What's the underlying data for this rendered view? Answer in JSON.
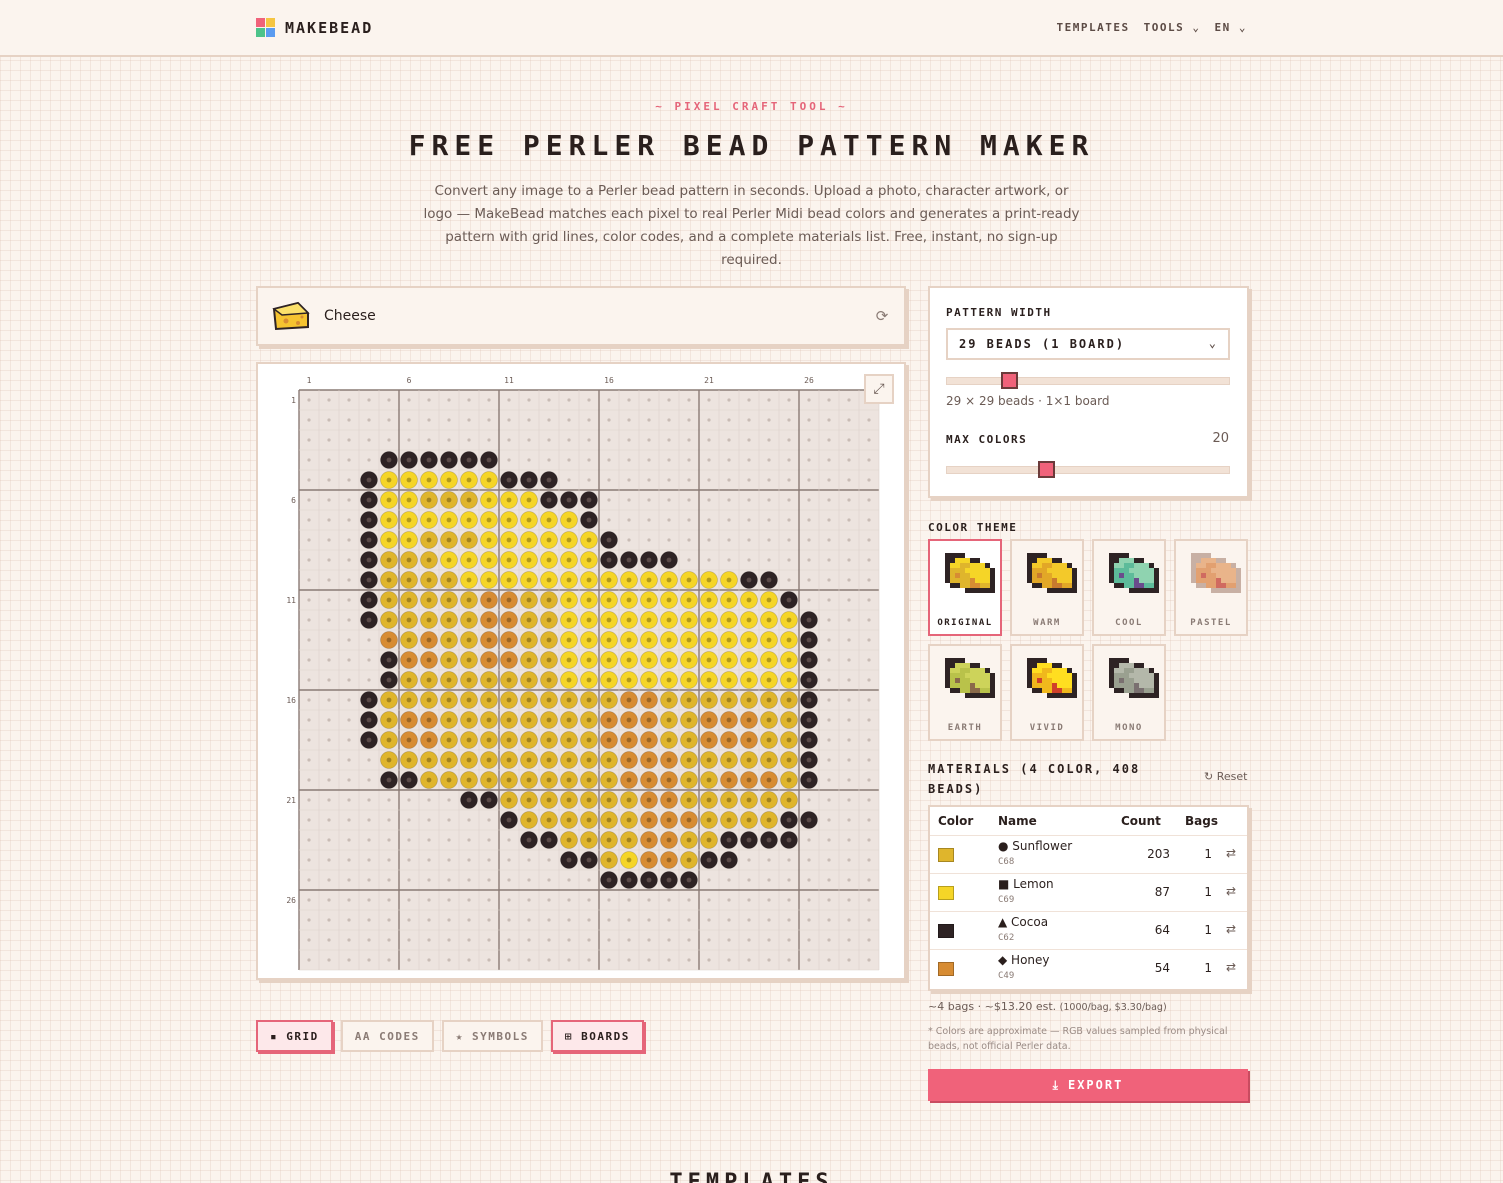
{
  "header": {
    "logo_text": "MAKEBEAD",
    "nav": [
      "TEMPLATES",
      "TOOLS ⌄",
      "EN ⌄"
    ]
  },
  "hero": {
    "kicker": "~ PIXEL CRAFT TOOL ~",
    "title": "FREE PERLER BEAD PATTERN MAKER",
    "description": "Convert any image to a Perler bead pattern in seconds. Upload a photo, character artwork, or logo — MakeBead matches each pixel to real Perler Midi bead colors and generates a print-ready pattern with grid lines, color codes, and a complete materials list. Free, instant, no sign-up required."
  },
  "image": {
    "label": "Cheese"
  },
  "grid": {
    "cols": 29,
    "rows": 29,
    "col_labels": [
      "1",
      "6",
      "11",
      "16",
      "21",
      "26"
    ],
    "row_labels": [
      "1",
      "6",
      "11",
      "16",
      "21",
      "26"
    ],
    "palette": {
      "A": "#dfb52c",
      "B": "#f5d527",
      "C": "#2e2324",
      "D": "#d78c33"
    },
    "rows_data": [
      ".............................",
      ".............................",
      ".............................",
      "....CCCCCC...................",
      "...CBBBBBBCCC................",
      "...CBBAAABBBCCC..............",
      "...CBBBBBBBBBBC..............",
      "...CBBAAABBBBBBC.............",
      "...CAAABBBBBBBBCCCC..........",
      "...CAAAABBBBBBBBBBBBBBCC.....",
      "...CAAAAADDAABBBBBBBBBBBC....",
      "...CAAAAADDAABBBBBBBBBBBBC...",
      "....DADAADDAABBBBBBBBBBBBC...",
      "....CDDAADDAABBBBBBBBBBBBC...",
      "....CAAAAAAAABBBBBBBBBBBBC...",
      "...CAAAAAAAAAAAADDAAAAAAAC...",
      "...CADDAAAAAAAADDDAADDDAAC...",
      "...CADDAAAAAAAADDDAADDDAAC...",
      "....AAAAAAAAAAAADDDAAAAAAC...",
      "....CCAAAAAAAAAADDDAADDDAC...",
      "........CCAAAAAAADDAAAAAA....",
      "..........CAAAAAADDDAAAACC...",
      "...........CCAAAADDAACCCC....",
      ".............CCABDDACC.......",
      "...............CCCCC.........",
      ".............................",
      ".............................",
      ".............................",
      "............................."
    ]
  },
  "toggles": [
    "▪ GRID",
    "AA CODES",
    "★ SYMBOLS",
    "⊞ BOARDS"
  ],
  "settings": {
    "width_label": "PATTERN WIDTH",
    "width_value": "29 BEADS (1 BOARD)",
    "width_slider_fraction": 0.2,
    "width_sub": "29 × 29 beads · 1×1 board",
    "max_colors_label": "MAX COLORS",
    "max_colors_value": "20",
    "max_colors_fraction": 0.34
  },
  "themes": {
    "label": "COLOR THEME",
    "items": [
      {
        "name": "ORIGINAL",
        "colors": [
          "#dfb52c",
          "#f5d527",
          "#2e2324",
          "#d78c33"
        ]
      },
      {
        "name": "WARM",
        "colors": [
          "#e2a727",
          "#f3c92a",
          "#2e2324",
          "#c97a2e"
        ]
      },
      {
        "name": "COOL",
        "colors": [
          "#5dbb9a",
          "#8fd3b0",
          "#2e2324",
          "#6a4c8c"
        ]
      },
      {
        "name": "PASTEL",
        "colors": [
          "#e2a070",
          "#e9b48a",
          "#c8b0a4",
          "#d06a60"
        ]
      },
      {
        "name": "EARTH",
        "colors": [
          "#b9c24a",
          "#cdd35a",
          "#2e2324",
          "#8a6a4a"
        ]
      },
      {
        "name": "VIVID",
        "colors": [
          "#f0b81c",
          "#ffde20",
          "#2e2324",
          "#d0402a"
        ]
      },
      {
        "name": "MONO",
        "colors": [
          "#9aa090",
          "#b4b8aa",
          "#2e2324",
          "#7a7070"
        ]
      }
    ]
  },
  "materials": {
    "title": "MATERIALS (4 COLOR, 408 BEADS)",
    "reset": "↻ Reset",
    "headers": [
      "Color",
      "Name",
      "Count",
      "Bags"
    ],
    "rows": [
      {
        "color": "#dfb52c",
        "name": "● Sunflower",
        "code": "C68",
        "count": "203",
        "bags": "1"
      },
      {
        "color": "#f5d527",
        "name": "■ Lemon",
        "code": "C69",
        "count": "87",
        "bags": "1"
      },
      {
        "color": "#2e2324",
        "name": "▲ Cocoa",
        "code": "C62",
        "count": "64",
        "bags": "1"
      },
      {
        "color": "#d78c33",
        "name": "◆ Honey",
        "code": "C49",
        "count": "54",
        "bags": "1"
      }
    ],
    "summary": "~4 bags · ~$13.20 est.",
    "summary_small": "(1000/bag, $3.30/bag)",
    "note": "* Colors are approximate — RGB values sampled from physical beads, not official Perler data."
  },
  "export_label": "EXPORT",
  "next_section": "TEMPLATES"
}
